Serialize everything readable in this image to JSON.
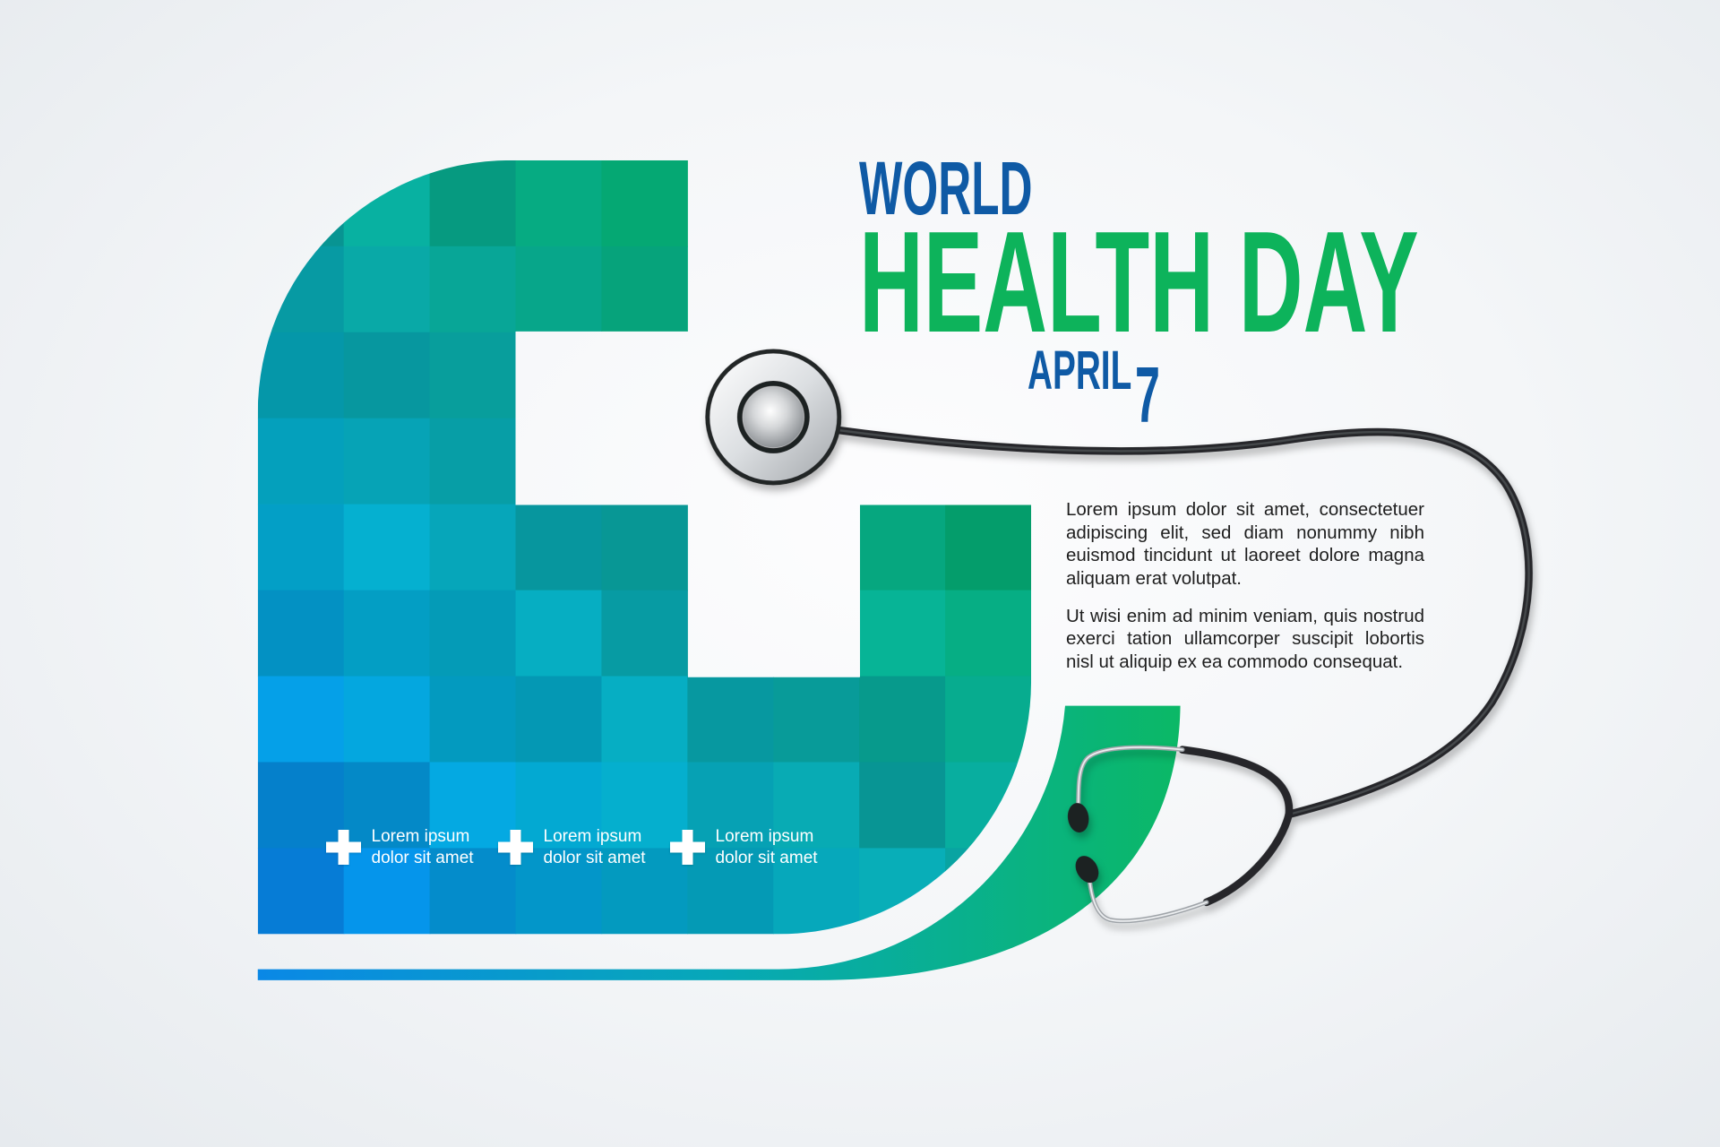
{
  "poster": {
    "title_line1": "WORLD",
    "title_line2": "HEALTH DAY",
    "date_month": "APRIL",
    "date_day": "7"
  },
  "body": {
    "paragraph1": "Lorem ipsum dolor sit amet, consectetuer adipiscing elit, sed diam nonummy nibh euismod tincidunt ut laoreet dolore magna aliquam erat volutpat.",
    "paragraph2": "Ut wisi enim ad minim veniam, quis nostrud exerci tation ullamcorper suscipit lobortis nisl ut aliquip ex ea commodo consequat."
  },
  "features": [
    {
      "icon": "plus-icon",
      "line1": "Lorem ipsum",
      "line2": "dolor sit amet"
    },
    {
      "icon": "plus-icon",
      "line1": "Lorem ipsum",
      "line2": "dolor sit amet"
    },
    {
      "icon": "plus-icon",
      "line1": "Lorem ipsum",
      "line2": "dolor sit amet"
    }
  ],
  "illustration": {
    "icon": "stethoscope-icon"
  },
  "colors": {
    "title_blue": "#0f5aa5",
    "title_green": "#0db35b",
    "body_text": "#1e1e1e",
    "background": "#eef1f4",
    "mosaic_stops": [
      "#0684e4",
      "#03aed8",
      "#09a8a6",
      "#05b27a",
      "#03c25c"
    ]
  }
}
